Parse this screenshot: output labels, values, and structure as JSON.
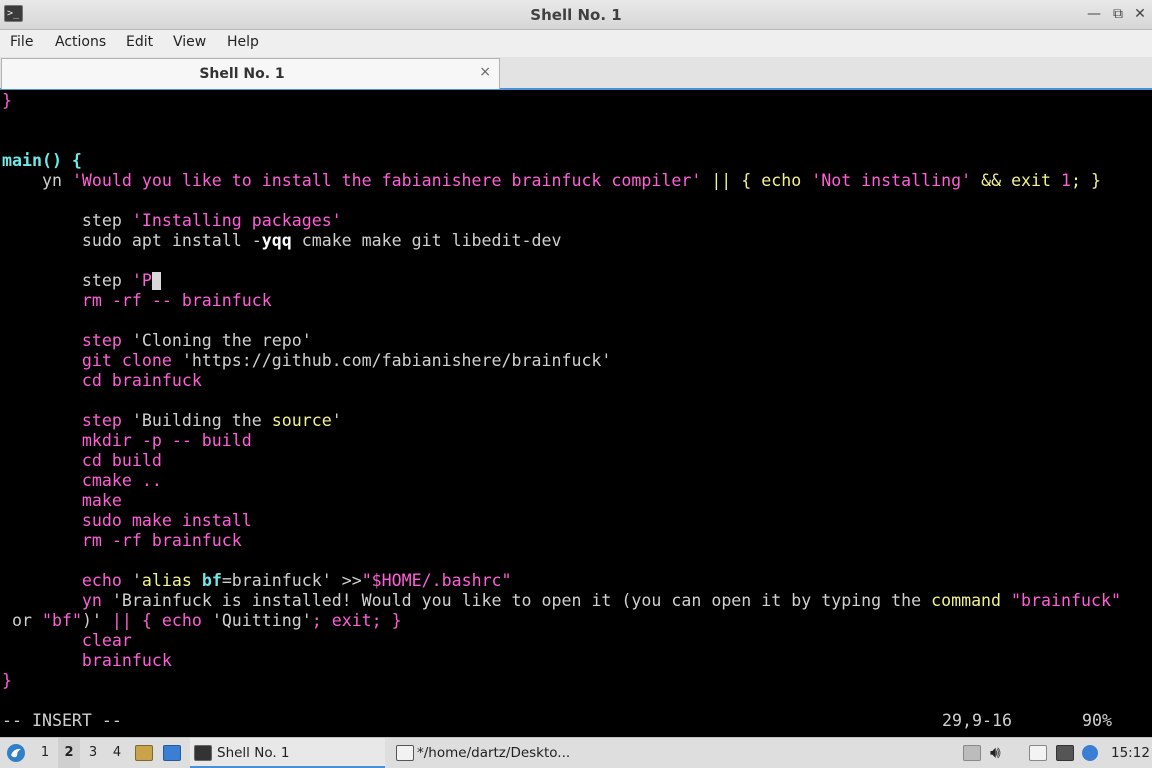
{
  "window": {
    "title": "Shell No. 1",
    "icon": "terminal-icon",
    "controls": {
      "minimize": "—",
      "maximize": "□",
      "restore": "⧉",
      "close": "✕"
    }
  },
  "menubar": {
    "items": [
      "File",
      "Actions",
      "Edit",
      "View",
      "Help"
    ]
  },
  "tab": {
    "label": "Shell No. 1",
    "close": "×"
  },
  "editor": {
    "lines": [
      {
        "segs": [
          [
            "}",
            "pk"
          ]
        ]
      },
      {
        "segs": []
      },
      {
        "segs": []
      },
      {
        "segs": [
          [
            "main() {",
            "cy"
          ]
        ]
      },
      {
        "segs": [
          [
            "    yn ",
            "gy"
          ],
          [
            "'Would you like to install the fabianishere brainfuck compiler'",
            "pk"
          ],
          [
            " || { ",
            "yl"
          ],
          [
            "echo ",
            "yl"
          ],
          [
            "'Not installing'",
            "pk"
          ],
          [
            " && ",
            "yl"
          ],
          [
            "exit ",
            "yl"
          ],
          [
            "1",
            "pk"
          ],
          [
            "; }",
            "yl"
          ]
        ]
      },
      {
        "segs": []
      },
      {
        "segs": [
          [
            "        step ",
            "gy"
          ],
          [
            "'Installing packages'",
            "pk"
          ]
        ]
      },
      {
        "segs": [
          [
            "        sudo apt install -",
            "gy"
          ],
          [
            "yqq",
            "wb"
          ],
          [
            " cmake make git libedit-dev",
            "gy"
          ]
        ]
      },
      {
        "segs": []
      },
      {
        "segs": [
          [
            "        step ",
            "gy"
          ],
          [
            "'P",
            "pk"
          ]
        ],
        "cursor": true
      },
      {
        "segs": [
          [
            "        rm -rf -- brainfuck",
            "pk"
          ]
        ]
      },
      {
        "segs": []
      },
      {
        "segs": [
          [
            "        step ",
            "pk"
          ],
          [
            "'Cloning the repo'",
            "gy"
          ]
        ]
      },
      {
        "segs": [
          [
            "        git clone ",
            "pk"
          ],
          [
            "'https://github.com/fabianishere/brainfuck'",
            "gy"
          ]
        ]
      },
      {
        "segs": [
          [
            "        cd brainfuck",
            "pk"
          ]
        ]
      },
      {
        "segs": []
      },
      {
        "segs": [
          [
            "        step ",
            "pk"
          ],
          [
            "'Building the ",
            "gy"
          ],
          [
            "source",
            "yl"
          ],
          [
            "'",
            "gy"
          ]
        ]
      },
      {
        "segs": [
          [
            "        mkdir -p -- build",
            "pk"
          ]
        ]
      },
      {
        "segs": [
          [
            "        cd build",
            "pk"
          ]
        ]
      },
      {
        "segs": [
          [
            "        cmake ..",
            "pk"
          ]
        ]
      },
      {
        "segs": [
          [
            "        make",
            "pk"
          ]
        ]
      },
      {
        "segs": [
          [
            "        sudo make install",
            "pk"
          ]
        ]
      },
      {
        "segs": [
          [
            "        rm -rf brainfuck",
            "pk"
          ]
        ]
      },
      {
        "segs": []
      },
      {
        "segs": [
          [
            "        echo ",
            "pk"
          ],
          [
            "'",
            "gy"
          ],
          [
            "alias ",
            "yl"
          ],
          [
            "bf",
            "cy"
          ],
          [
            "=brainfuck' ",
            "gy"
          ],
          [
            ">>",
            "gy"
          ],
          [
            "\"$HOME/.bashrc\"",
            "pk"
          ]
        ]
      },
      {
        "segs": [
          [
            "        yn ",
            "pk"
          ],
          [
            "'Brainfuck is installed! Would you like to open it (you can open it by typing the ",
            "gy"
          ],
          [
            "command",
            "yl"
          ],
          [
            " ",
            "gy"
          ],
          [
            "\"brainfuck\"",
            "pk"
          ]
        ]
      },
      {
        "segs": [
          [
            " or ",
            "gy"
          ],
          [
            "\"bf\"",
            "pk"
          ],
          [
            ")' ",
            "gy"
          ],
          [
            "|| { ",
            "pk"
          ],
          [
            "echo ",
            "pk"
          ],
          [
            "'Quitting'",
            "gy"
          ],
          [
            "; exit; }",
            "pk"
          ]
        ]
      },
      {
        "segs": [
          [
            "        clear",
            "pk"
          ]
        ]
      },
      {
        "segs": [
          [
            "        brainfuck",
            "pk"
          ]
        ]
      },
      {
        "segs": [
          [
            "}",
            "pk"
          ]
        ]
      }
    ],
    "status": {
      "mode": "-- INSERT --",
      "position": "29,9-16",
      "percent": "90%"
    }
  },
  "taskbar": {
    "start_icon": "menu-logo-icon",
    "workspaces": [
      "1",
      "2",
      "3",
      "4"
    ],
    "active_workspace": "2",
    "launchers": [
      "file-manager-icon",
      "show-desktop-icon"
    ],
    "tasks": [
      {
        "label": "Shell No. 1",
        "icon": "terminal-icon",
        "active": true
      },
      {
        "label": "*/home/dartz/Deskto...",
        "icon": "text-editor-icon",
        "active": false
      }
    ],
    "tray": [
      "upload-icon",
      "volume-icon",
      "clipboard-icon",
      "monitor-icon",
      "update-icon"
    ],
    "clock": "15:12",
    "colors": {
      "accent": "#4a90d9",
      "editor_bg": "#000000"
    }
  }
}
